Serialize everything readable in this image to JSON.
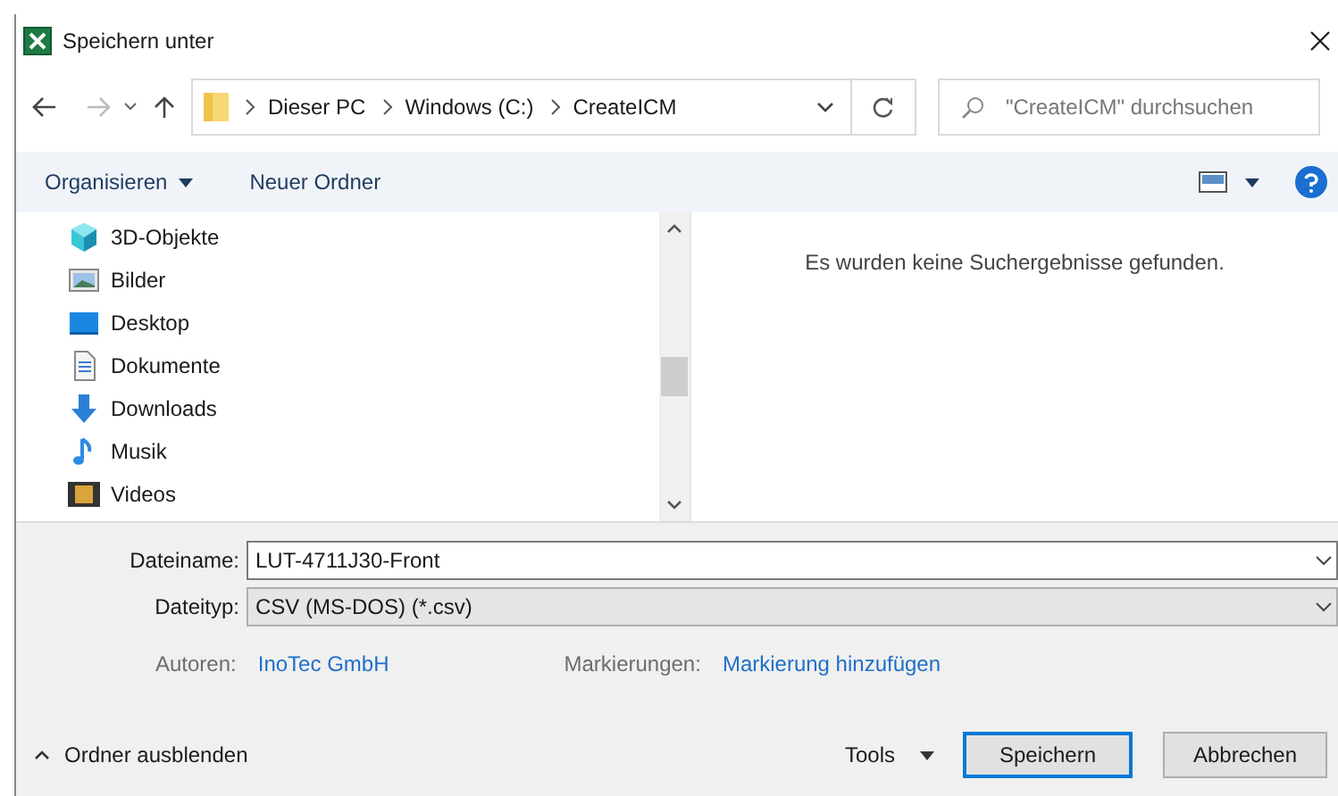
{
  "window": {
    "title": "Speichern unter"
  },
  "address_bar": {
    "path": [
      {
        "label": "Dieser PC"
      },
      {
        "label": "Windows  (C:)"
      },
      {
        "label": "CreateICM"
      }
    ]
  },
  "search": {
    "placeholder": "\"CreateICM\" durchsuchen"
  },
  "toolbar": {
    "organize": "Organisieren",
    "new_folder": "Neuer Ordner"
  },
  "nav_items": [
    {
      "label": "3D-Objekte",
      "kind": "cube"
    },
    {
      "label": "Bilder",
      "kind": "pictures"
    },
    {
      "label": "Desktop",
      "kind": "desktop"
    },
    {
      "label": "Dokumente",
      "kind": "documents"
    },
    {
      "label": "Downloads",
      "kind": "downloads"
    },
    {
      "label": "Musik",
      "kind": "music"
    },
    {
      "label": "Videos",
      "kind": "videos"
    }
  ],
  "results_message": "Es wurden keine Suchergebnisse gefunden.",
  "filename": {
    "label": "Dateiname:",
    "value": "LUT-4711J30-Front"
  },
  "filetype": {
    "label": "Dateityp:",
    "value": "CSV (MS-DOS) (*.csv)"
  },
  "authors": {
    "label": "Autoren:",
    "value": "InoTec GmbH"
  },
  "tags": {
    "label": "Markierungen:",
    "value": "Markierung hinzufügen"
  },
  "hide_folders": "Ordner ausblenden",
  "buttons": {
    "tools": "Tools",
    "save": "Speichern",
    "cancel": "Abbrechen"
  }
}
